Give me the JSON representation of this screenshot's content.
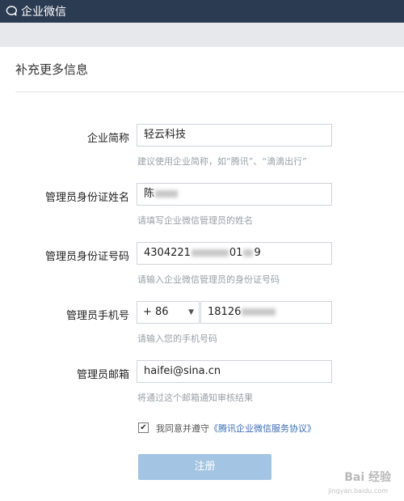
{
  "topbar": {
    "app_title": "企业微信"
  },
  "form": {
    "title": "补充更多信息",
    "company": {
      "label": "企业简称",
      "value": "轻云科技",
      "hint": "建议使用企业简称，如“腾讯”、“滴滴出行”"
    },
    "admin_name": {
      "label": "管理员身份证姓名",
      "value": "陈",
      "hint": "请填写企业微信管理员的姓名"
    },
    "admin_id": {
      "label": "管理员身份证号码",
      "value_start": "4304221",
      "value_mid": "01",
      "value_end": "9",
      "hint": "请输入企业微信管理员的身份证号码"
    },
    "admin_phone": {
      "label": "管理员手机号",
      "country_code": "+ 86",
      "value": "18126",
      "hint": "请输入您的手机号码"
    },
    "admin_email": {
      "label": "管理员邮箱",
      "value": "haifei@sina.cn",
      "hint": "将通过这个邮箱通知审核结果"
    },
    "agreement": {
      "prefix": "我同意并遵守",
      "link": "《腾讯企业微信服务协议》",
      "checked": true
    },
    "submit_label": "注册"
  },
  "watermark": {
    "text": "Bai 经验",
    "sub": "jingyan.baidu.com"
  },
  "colors": {
    "topbar": "#2b3b52",
    "button": "#a3c4e3",
    "link": "#3a6db5"
  }
}
